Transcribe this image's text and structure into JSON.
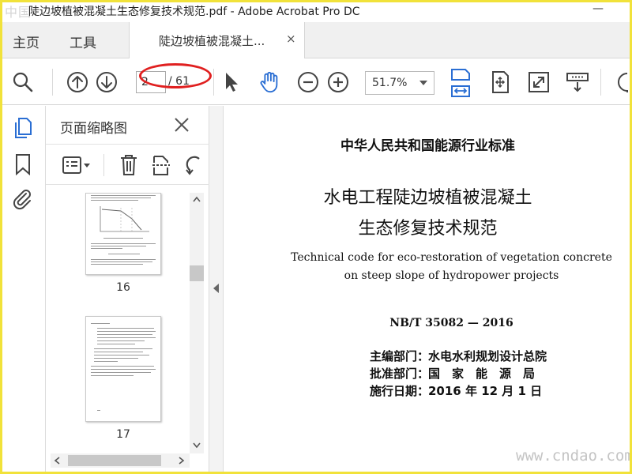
{
  "window": {
    "title": "陡边坡植被混凝土生态修复技术规范.pdf - Adobe Acrobat Pro DC",
    "logo_text": "中国"
  },
  "tabs": {
    "home": "主页",
    "tools": "工具",
    "document": "陡边坡植被混凝土...",
    "close_glyph": "×"
  },
  "toolbar": {
    "current_page": "2",
    "total_pages": "/ 61",
    "zoom": "51.7%"
  },
  "thumbnail_panel": {
    "title": "页面缩略图",
    "thumbnails": [
      {
        "page_label": "16"
      },
      {
        "page_label": "17"
      }
    ]
  },
  "document": {
    "header": "中华人民共和国能源行业标准",
    "title_line1": "水电工程陡边坡植被混凝土",
    "title_line2": "生态修复技术规范",
    "english_line1": "Technical code for eco-restoration of vegetation concrete",
    "english_line2": "on steep slope of hydropower projects",
    "standard_number": "NB/T  35082 — 2016",
    "meta": [
      {
        "label": "主编部门：",
        "value": "水电水利规划设计总院"
      },
      {
        "label": "批准部门：",
        "value": "国　家　能　源　局"
      },
      {
        "label": "施行日期：",
        "value": "2016 年  12 月  1 日"
      }
    ]
  },
  "watermark": "www.cndao.com",
  "colors": {
    "accent_blue": "#2a6ed3",
    "annotation_red": "#e02020",
    "frame_yellow": "#f1e23a"
  }
}
